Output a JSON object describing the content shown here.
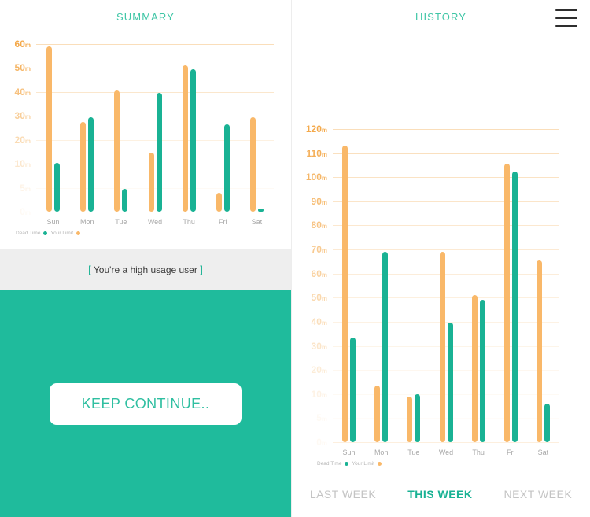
{
  "left": {
    "title": "SUMMARY",
    "notice": {
      "open_bracket": "[",
      "text": "You're a high usage user",
      "close_bracket": "]"
    },
    "cta": {
      "label": "KEEP CONTINUE.."
    },
    "legend": {
      "dead_label": "Dead Time",
      "limit_label": "Your Limit"
    }
  },
  "right": {
    "title": "HISTORY",
    "menu_icon": "hamburger-menu-icon",
    "legend": {
      "dead_label": "Dead Time",
      "limit_label": "Your Limit"
    },
    "tabs": [
      {
        "label": "LAST WEEK",
        "active": false
      },
      {
        "label": "THIS WEEK",
        "active": true
      },
      {
        "label": "NEXT WEEK",
        "active": false
      }
    ]
  },
  "colors": {
    "limit": "#f9b869",
    "dead": "#19b294",
    "title": "#3fc6a6",
    "grid": "#f7c98f",
    "ytick": "#f4a94b",
    "xtick": "#a8a8a8",
    "notice_bg": "#eeeeee",
    "green_block": "#1fbb9c",
    "tab_inactive": "#c4c4c4",
    "tab_active": "#19b294"
  },
  "chart_data": [
    {
      "id": "summary",
      "type": "bar",
      "title": "SUMMARY",
      "xlabel": "",
      "ylabel": "",
      "unit": "m",
      "ylim": [
        0,
        60
      ],
      "grid": true,
      "legend_position": "bottom-left",
      "ticks": [
        {
          "value": 60,
          "label": "60",
          "unit": "m"
        },
        {
          "value": 50,
          "label": "50",
          "unit": "m"
        },
        {
          "value": 40,
          "label": "40",
          "unit": "m"
        },
        {
          "value": 30,
          "label": "30",
          "unit": "m"
        },
        {
          "value": 20,
          "label": "20",
          "unit": "m"
        },
        {
          "value": 10,
          "label": "10",
          "unit": "m"
        },
        {
          "value": 5,
          "label": "5",
          "unit": "m"
        },
        {
          "value": 0,
          "label": "0",
          "unit": "m"
        }
      ],
      "categories": [
        "Sun",
        "Mon",
        "Tue",
        "Wed",
        "Thu",
        "Fri",
        "Sat"
      ],
      "series": [
        {
          "name": "Your Limit",
          "color": "#f9b869",
          "values": [
            59,
            27.5,
            40.5,
            14.5,
            51,
            4,
            29.5
          ]
        },
        {
          "name": "Dead Time",
          "color": "#19b294",
          "values": [
            10.5,
            29.5,
            4.8,
            39.5,
            49.5,
            26.5,
            0.6
          ]
        }
      ]
    },
    {
      "id": "history",
      "type": "bar",
      "title": "HISTORY",
      "xlabel": "",
      "ylabel": "",
      "unit": "m",
      "ylim": [
        0,
        120
      ],
      "grid": true,
      "legend_position": "bottom-left",
      "ticks": [
        {
          "value": 120,
          "label": "120",
          "unit": "m"
        },
        {
          "value": 110,
          "label": "110",
          "unit": "m"
        },
        {
          "value": 100,
          "label": "100",
          "unit": "m"
        },
        {
          "value": 90,
          "label": "90",
          "unit": "m"
        },
        {
          "value": 80,
          "label": "80",
          "unit": "m"
        },
        {
          "value": 70,
          "label": "70",
          "unit": "m"
        },
        {
          "value": 60,
          "label": "60",
          "unit": "m"
        },
        {
          "value": 50,
          "label": "50",
          "unit": "m"
        },
        {
          "value": 40,
          "label": "40",
          "unit": "m"
        },
        {
          "value": 30,
          "label": "30",
          "unit": "m"
        },
        {
          "value": 20,
          "label": "20",
          "unit": "m"
        },
        {
          "value": 10,
          "label": "10",
          "unit": "m"
        },
        {
          "value": 5,
          "label": "5",
          "unit": "m"
        },
        {
          "value": 0,
          "label": "0",
          "unit": "m"
        }
      ],
      "categories": [
        "Sun",
        "Mon",
        "Tue",
        "Wed",
        "Thu",
        "Fri",
        "Sat"
      ],
      "series": [
        {
          "name": "Your Limit",
          "color": "#f9b869",
          "values": [
            113,
            13.5,
            9.5,
            69,
            51,
            105.5,
            65.5
          ]
        },
        {
          "name": "Dead Time",
          "color": "#19b294",
          "values": [
            33.5,
            69,
            10,
            39.5,
            49,
            102.5,
            8
          ]
        }
      ]
    }
  ]
}
